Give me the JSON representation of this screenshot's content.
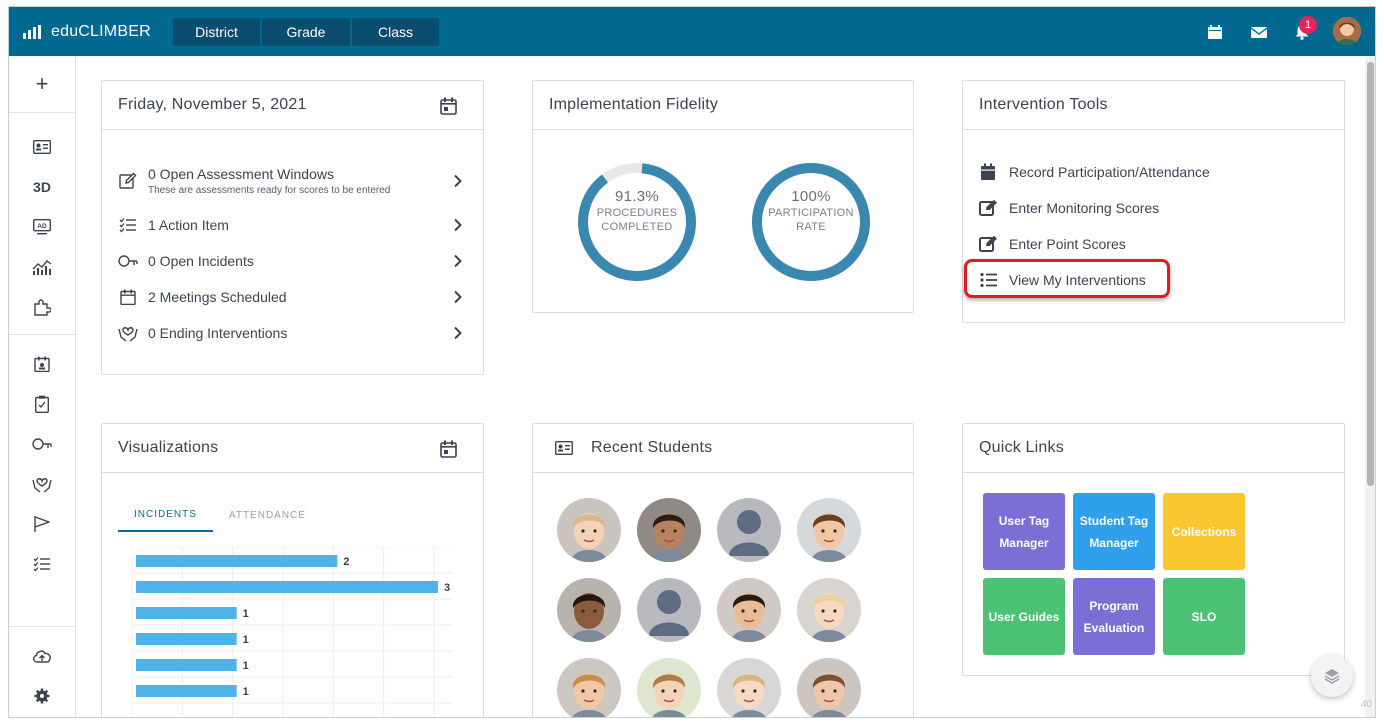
{
  "app": {
    "name": "eduCLIMBER"
  },
  "nav": {
    "tabs": [
      "District",
      "Grade",
      "Class"
    ]
  },
  "header": {
    "notification_count": "1"
  },
  "sidebar": {
    "label_3d": "3D"
  },
  "date_card": {
    "title": "Friday, November 5, 2021",
    "items": [
      {
        "label": "0 Open Assessment Windows",
        "sub": "These are assessments ready for scores to be entered"
      },
      {
        "label": "1 Action Item"
      },
      {
        "label": "0 Open Incidents"
      },
      {
        "label": "2 Meetings Scheduled"
      },
      {
        "label": "0 Ending Interventions"
      }
    ]
  },
  "fidelity_card": {
    "title": "Implementation Fidelity",
    "donuts": [
      {
        "pct": "91.3%",
        "line1": "PROCEDURES",
        "line2": "COMPLETED",
        "value": 0.913
      },
      {
        "pct": "100%",
        "line1": "PARTICIPATION",
        "line2": "RATE",
        "value": 1.0
      }
    ]
  },
  "tools_card": {
    "title": "Intervention Tools",
    "items": [
      "Record Participation/Attendance",
      "Enter Monitoring Scores",
      "Enter Point Scores",
      "View My Interventions"
    ]
  },
  "viz_card": {
    "title": "Visualizations",
    "tabs": [
      "INCIDENTS",
      "ATTENDANCE"
    ]
  },
  "chart_data": {
    "type": "bar",
    "orientation": "horizontal",
    "values": [
      2,
      3,
      1,
      1,
      1,
      1
    ],
    "xlim": [
      0,
      3
    ],
    "grid": true,
    "colors": {
      "bar": "#4db3e8"
    }
  },
  "recent_card": {
    "title": "Recent Students"
  },
  "quicklinks_card": {
    "title": "Quick Links",
    "links": [
      {
        "label": "User Tag Manager",
        "color": "#7b6fd6"
      },
      {
        "label": "Student Tag Manager",
        "color": "#2ea0ec"
      },
      {
        "label": "Collections",
        "color": "#fbc72f"
      },
      {
        "label": "User Guides",
        "color": "#4cc374"
      },
      {
        "label": "Program Evaluation",
        "color": "#7b6fd6"
      },
      {
        "label": "SLO",
        "color": "#4cc374"
      }
    ]
  },
  "footer": {
    "page_number": "40"
  },
  "colors": {
    "primary": "#01688f",
    "nav_tab": "#0b4d6e",
    "donut": "#3a87b0",
    "highlight": "#e11b22"
  }
}
